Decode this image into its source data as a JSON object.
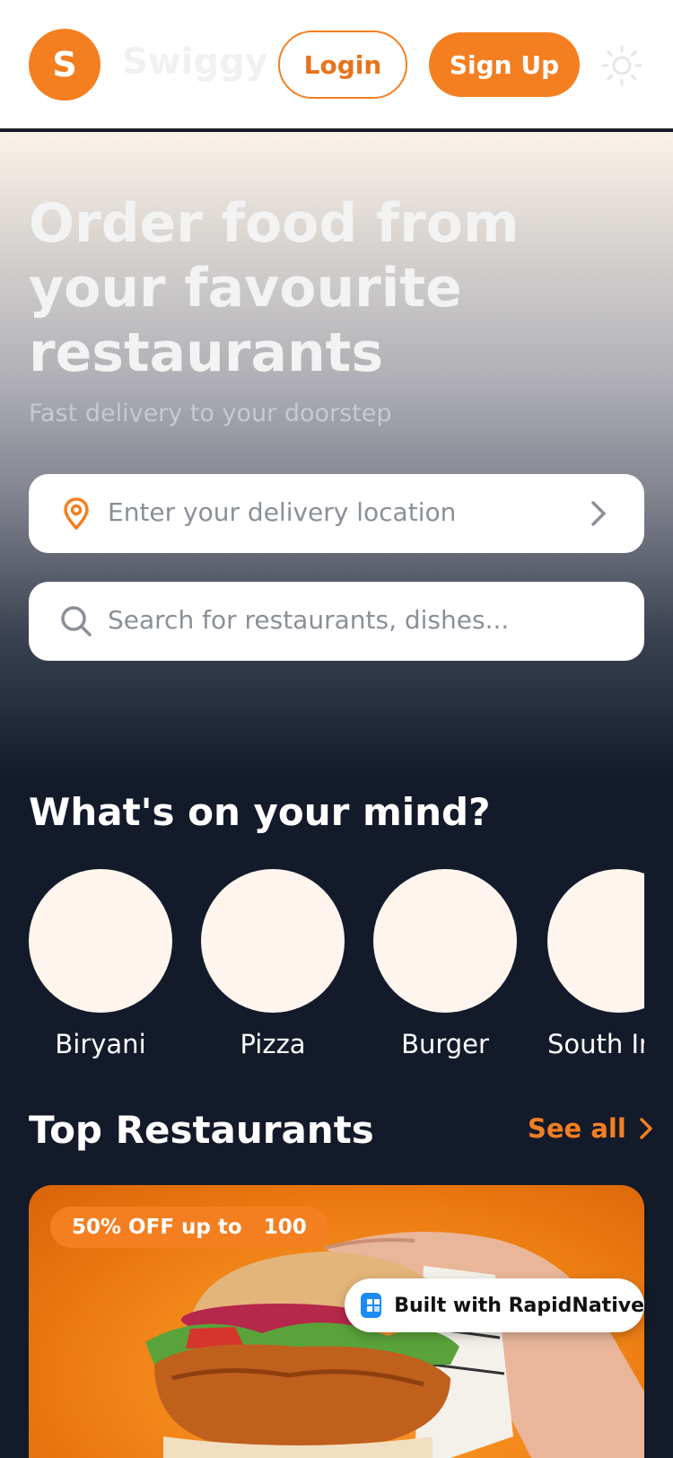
{
  "header": {
    "logo_letter": "S",
    "brand": "Swiggy",
    "login_label": "Login",
    "signup_label": "Sign Up",
    "theme_icon": "sun-icon"
  },
  "hero": {
    "title": "Order food from your favourite restaurants",
    "subtitle": "Fast delivery to your doorstep",
    "location_placeholder": "Enter your delivery location",
    "search_placeholder": "Search for restaurants, dishes..."
  },
  "categories": {
    "title": "What's on your mind?",
    "items": [
      {
        "label": "Biryani"
      },
      {
        "label": "Pizza"
      },
      {
        "label": "Burger"
      },
      {
        "label": "South Indian"
      }
    ]
  },
  "restaurants": {
    "title": "Top Restaurants",
    "see_all": "See all",
    "card": {
      "offer": "50% OFF up to   100"
    }
  },
  "badge": {
    "label": "Built with RapidNative"
  },
  "colors": {
    "accent": "#f47f20",
    "background": "#131a2a",
    "category_bubble": "#fdf5ee"
  }
}
